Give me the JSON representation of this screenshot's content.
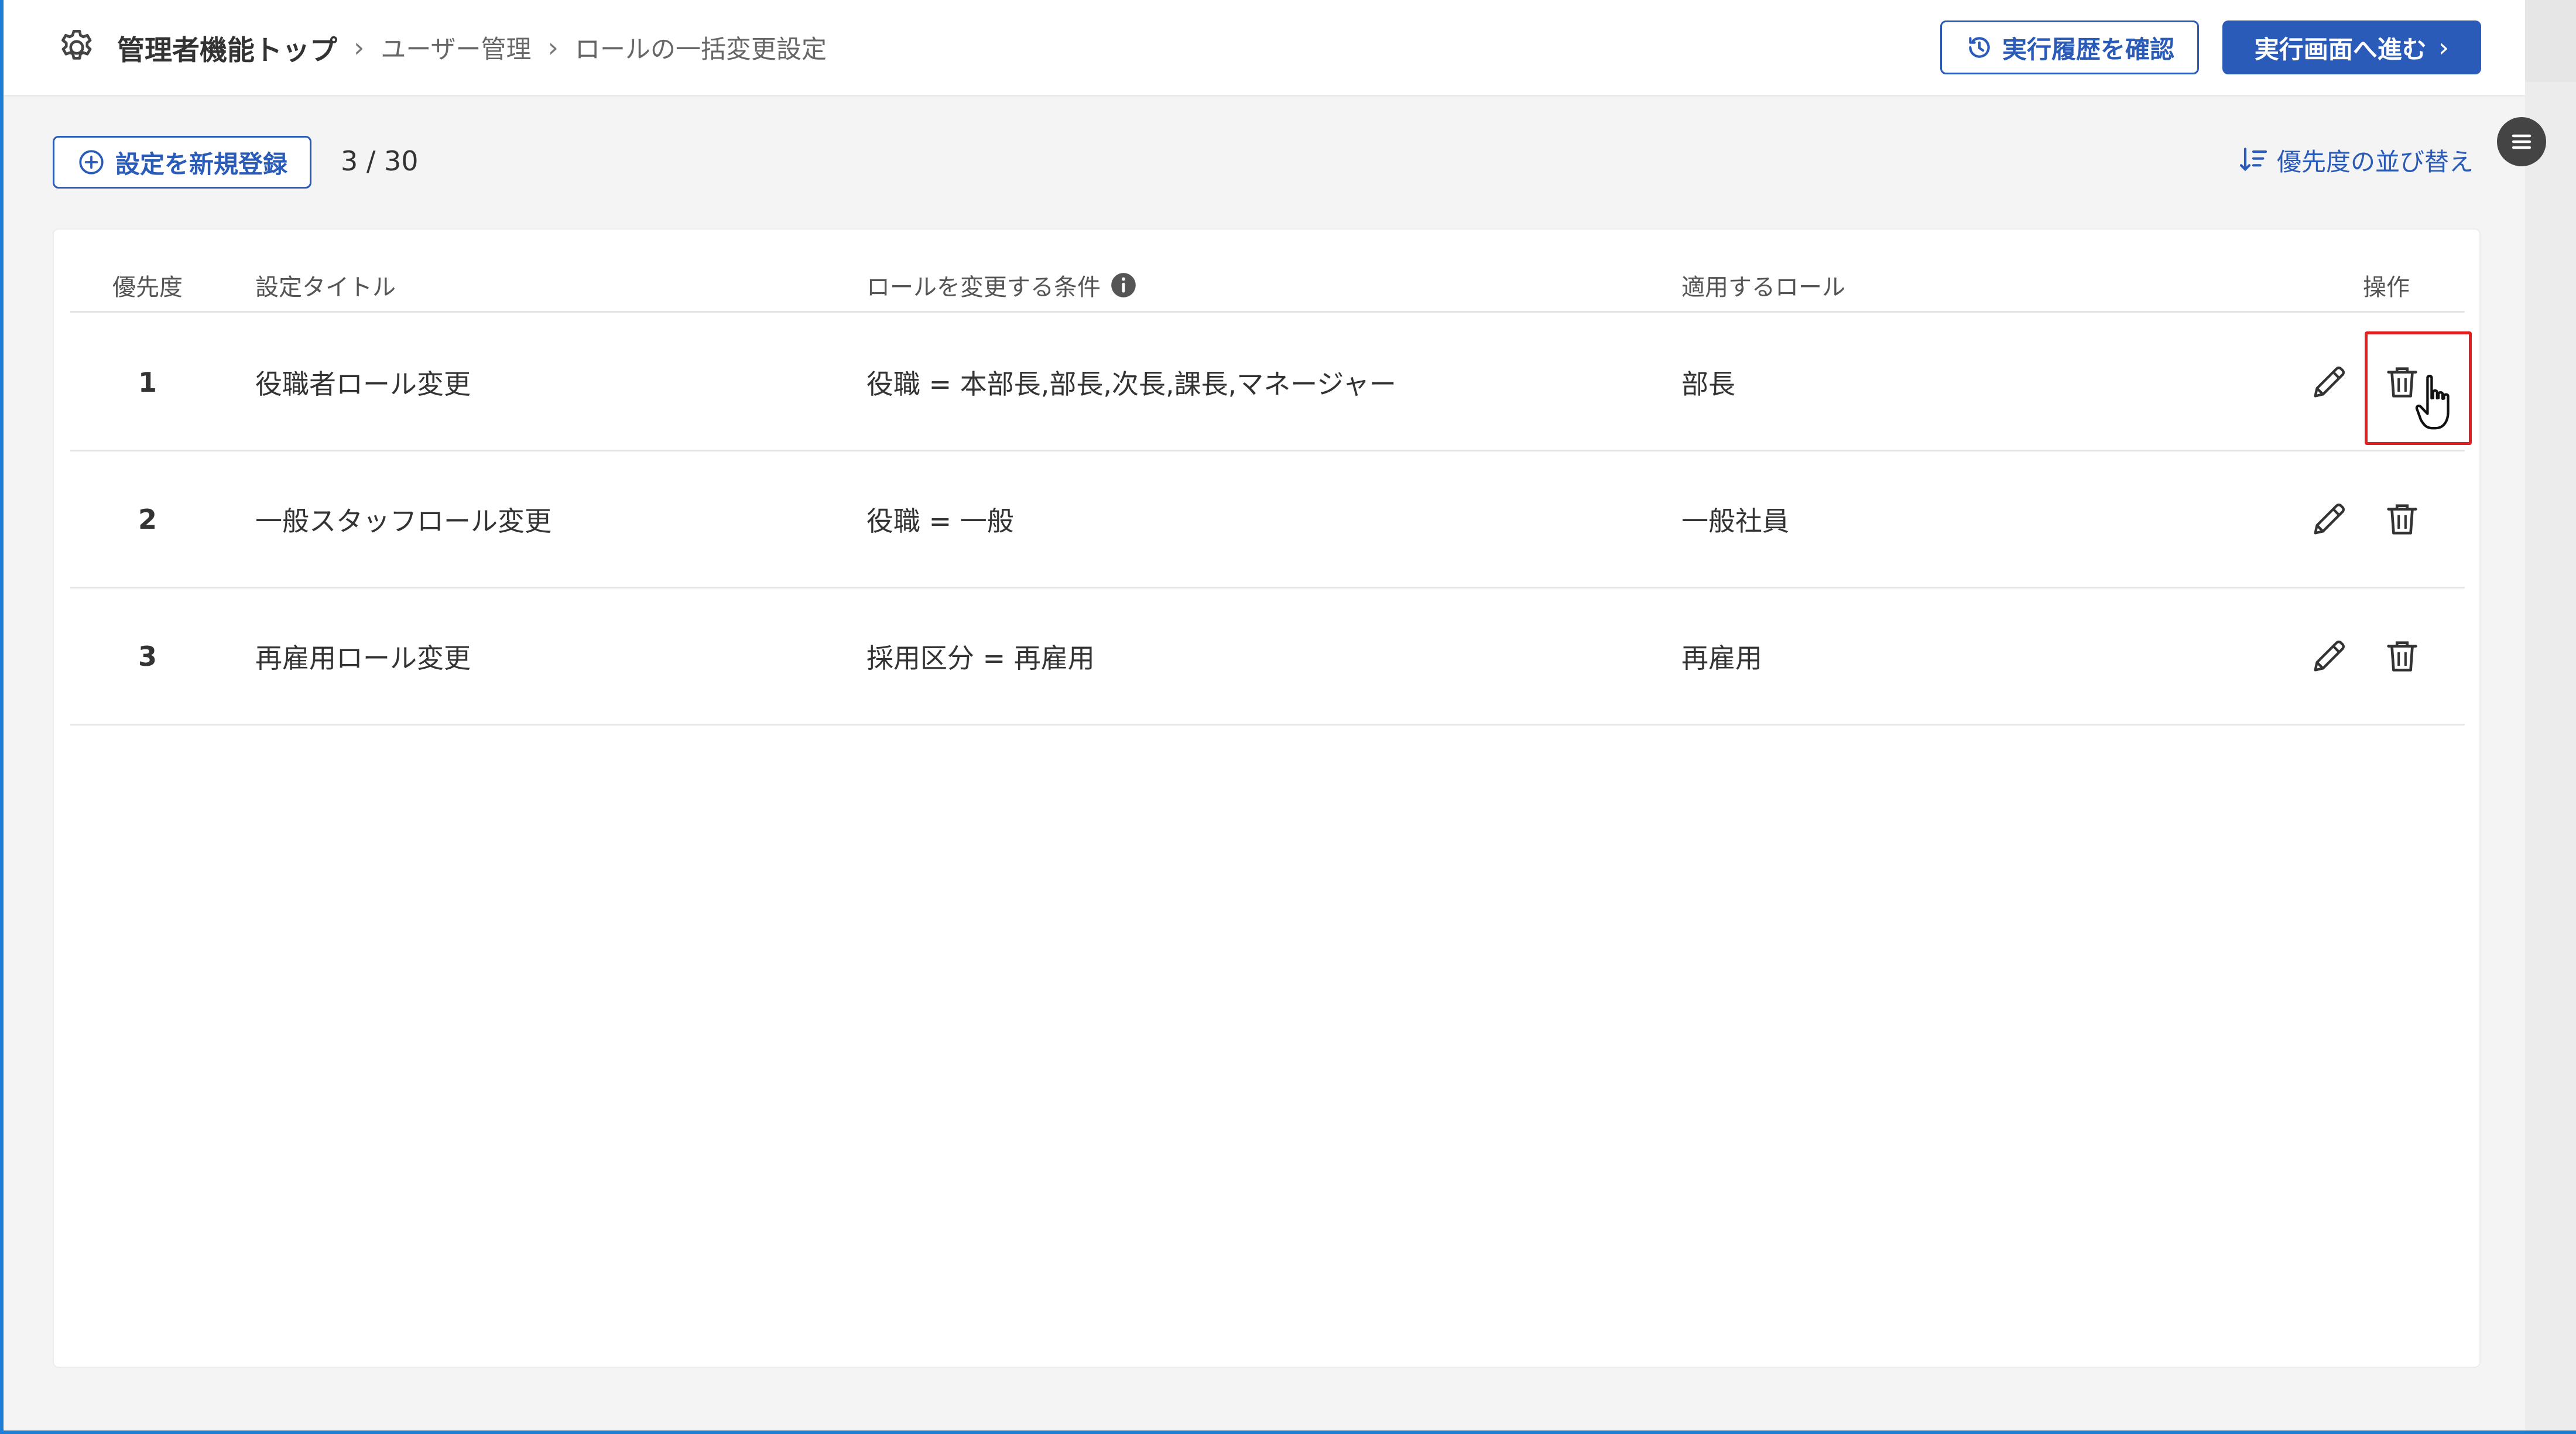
{
  "breadcrumb": {
    "root": "管理者機能トップ",
    "items": [
      "ユーザー管理",
      "ロールの一括変更設定"
    ]
  },
  "header": {
    "history_button": "実行履歴を確認",
    "proceed_button": "実行画面へ進む"
  },
  "toolbar": {
    "new_button": "設定を新規登録",
    "count": "3 / 30",
    "sort_link": "優先度の並び替え"
  },
  "table": {
    "columns": {
      "priority": "優先度",
      "title": "設定タイトル",
      "condition": "ロールを変更する条件",
      "role": "適用するロール",
      "actions": "操作"
    },
    "rows": [
      {
        "priority": "1",
        "title": "役職者ロール変更",
        "condition": "役職 = 本部長,部長,次長,課長,マネージャー",
        "role": "部長"
      },
      {
        "priority": "2",
        "title": "一般スタッフロール変更",
        "condition": "役職 = 一般",
        "role": "一般社員"
      },
      {
        "priority": "3",
        "title": "再雇用ロール変更",
        "condition": "採用区分 = 再雇用",
        "role": "再雇用"
      }
    ]
  },
  "colors": {
    "accent": "#2a5bb8",
    "highlight": "#e02020",
    "frame": "#1e7ed6"
  },
  "icons": [
    "gear-icon",
    "history-icon",
    "plus-circle-icon",
    "sort-icon",
    "menu-icon",
    "info-icon",
    "edit-icon",
    "trash-icon",
    "hand-cursor-icon"
  ]
}
